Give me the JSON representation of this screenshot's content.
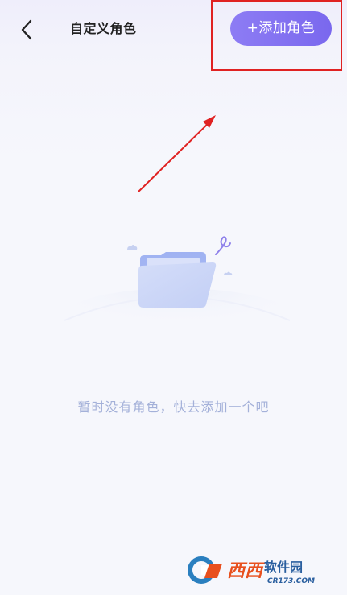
{
  "header": {
    "back_icon": "chevron-left-icon",
    "title": "自定义角色",
    "add_button_label": "+添加角色"
  },
  "empty_state": {
    "illustration": "folder-icon",
    "message": "暂时没有角色，快去添加一个吧"
  },
  "annotation": {
    "highlight_color": "#e02222",
    "arrow_color": "#e02222"
  },
  "watermark": {
    "logo": "cr173-logo",
    "name": "西西软件园",
    "domain": "CR173.COM"
  },
  "colors": {
    "accent": "#7f6ef0",
    "background": "#f6f7fc",
    "empty_text": "#a4b1d9"
  }
}
